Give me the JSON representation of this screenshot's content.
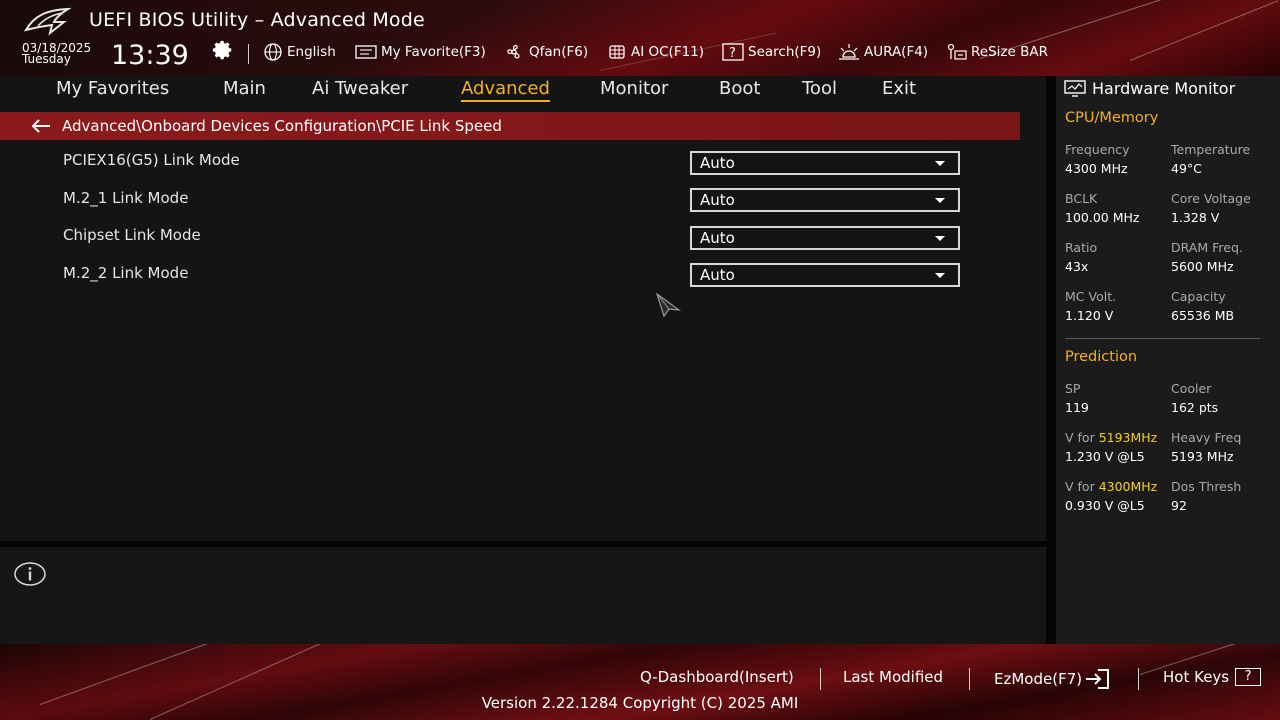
{
  "header": {
    "title": "UEFI BIOS Utility – Advanced Mode",
    "date": "03/18/2025",
    "weekday": "Tuesday",
    "time": "13:39",
    "quick_bar": [
      {
        "label": "English",
        "icon": "globe-icon"
      },
      {
        "label": "My Favorite(F3)",
        "icon": "favorite-list-icon"
      },
      {
        "label": "Qfan(F6)",
        "icon": "fan-icon"
      },
      {
        "label": "AI OC(F11)",
        "icon": "ai-chip-icon"
      },
      {
        "label": "Search(F9)",
        "icon": "search-question-icon"
      },
      {
        "label": "AURA(F4)",
        "icon": "aura-light-icon"
      },
      {
        "label": "ReSize BAR",
        "icon": "resize-bar-icon"
      }
    ]
  },
  "nav": {
    "tabs": [
      {
        "label": "My Favorites"
      },
      {
        "label": "Main"
      },
      {
        "label": "Ai Tweaker"
      },
      {
        "label": "Advanced"
      },
      {
        "label": "Monitor"
      },
      {
        "label": "Boot"
      },
      {
        "label": "Tool"
      },
      {
        "label": "Exit"
      }
    ],
    "active": "Advanced"
  },
  "breadcrumb": "Advanced\\Onboard Devices Configuration\\PCIE Link Speed",
  "settings": [
    {
      "label": "PCIEX16(G5) Link Mode",
      "value": "Auto"
    },
    {
      "label": "M.2_1 Link Mode",
      "value": "Auto"
    },
    {
      "label": "Chipset Link Mode",
      "value": "Auto"
    },
    {
      "label": "M.2_2 Link Mode",
      "value": "Auto"
    }
  ],
  "hw_monitor": {
    "title": "Hardware Monitor",
    "cpu_memory": {
      "section": "CPU/Memory",
      "frequency": {
        "label": "Frequency",
        "value": "4300 MHz"
      },
      "temperature": {
        "label": "Temperature",
        "value": "49°C"
      },
      "bclk": {
        "label": "BCLK",
        "value": "100.00 MHz"
      },
      "core_voltage": {
        "label": "Core Voltage",
        "value": "1.328 V"
      },
      "ratio": {
        "label": "Ratio",
        "value": "43x"
      },
      "dram_freq": {
        "label": "DRAM Freq.",
        "value": "5600 MHz"
      },
      "mc_volt": {
        "label": "MC Volt.",
        "value": "1.120 V"
      },
      "capacity": {
        "label": "Capacity",
        "value": "65536 MB"
      }
    },
    "prediction": {
      "section": "Prediction",
      "sp": {
        "label": "SP",
        "value": "119"
      },
      "cooler": {
        "label": "Cooler",
        "value": "162 pts"
      },
      "v_for_1": {
        "prefix": "V for ",
        "freq": "5193MHz",
        "value": "1.230 V @L5"
      },
      "heavy_freq": {
        "label": "Heavy Freq",
        "value": "5193 MHz"
      },
      "v_for_2": {
        "prefix": "V for ",
        "freq": "4300MHz",
        "value": "0.930 V @L5"
      },
      "dos_thresh": {
        "label": "Dos Thresh",
        "value": "92"
      }
    }
  },
  "footer": {
    "q_dashboard": "Q-Dashboard(Insert)",
    "last_modified": "Last Modified",
    "ezmode": "EzMode(F7)",
    "hot_keys": "Hot Keys",
    "hot_keys_glyph": "?",
    "version": "Version 2.22.1284 Copyright (C) 2025 AMI"
  },
  "colors": {
    "accent": "#f2b11a",
    "highlight": "#f2d21a",
    "breadcrumb_bg": "#8c1a1d",
    "background": "#141414"
  }
}
